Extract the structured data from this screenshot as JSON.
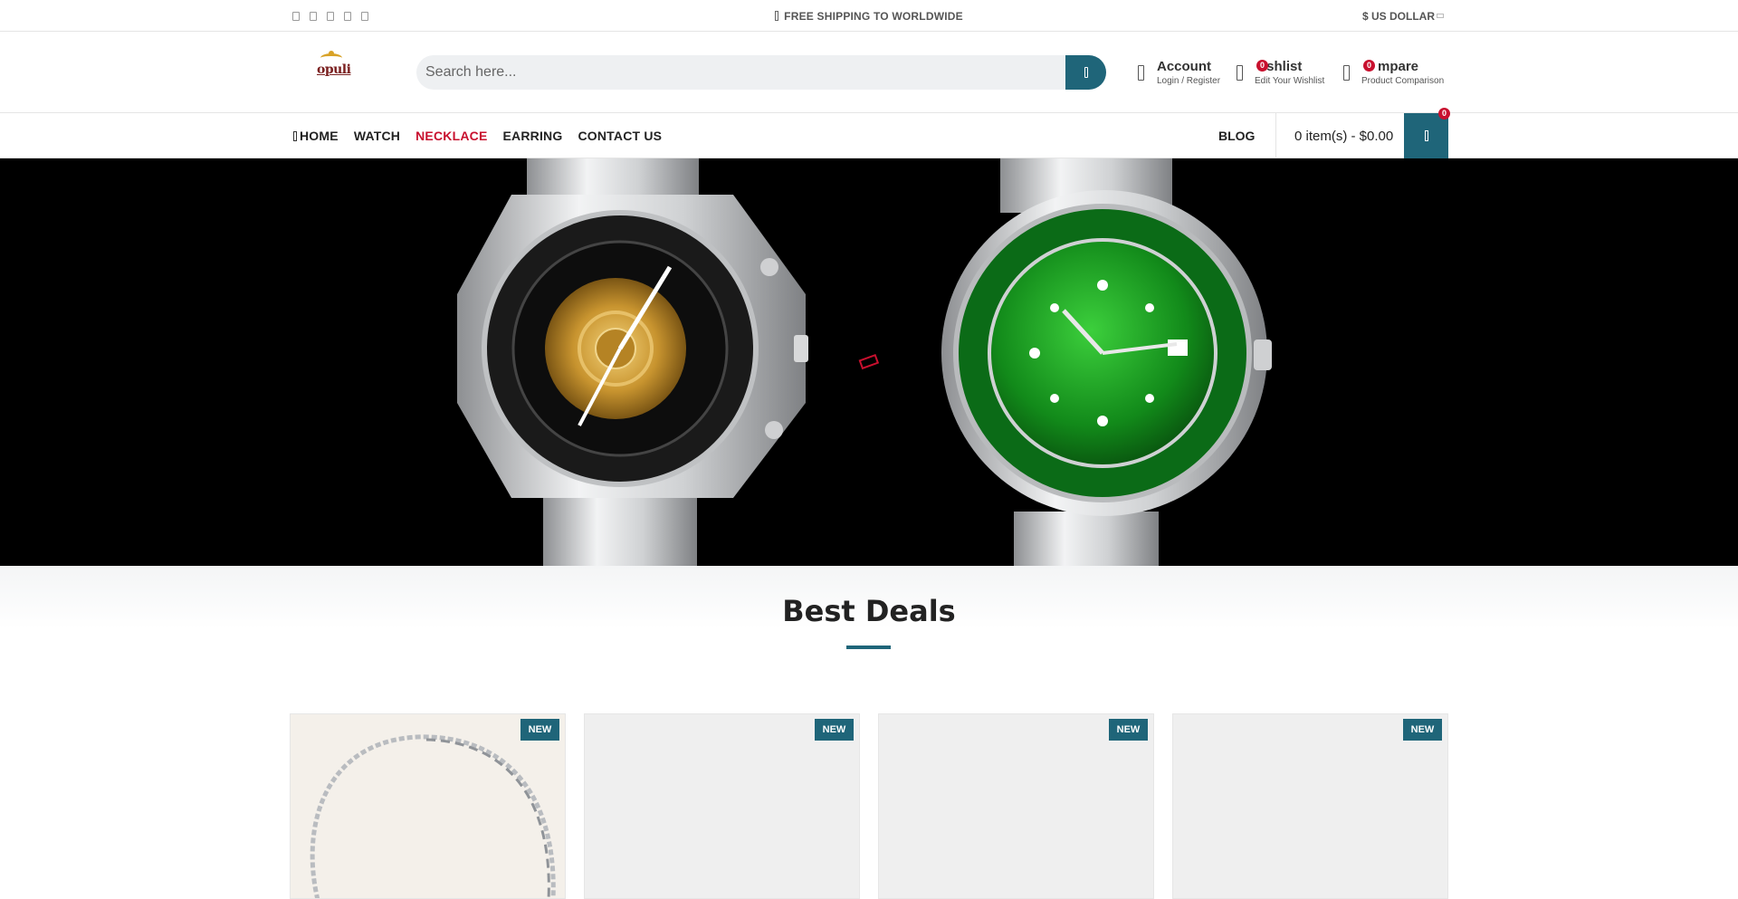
{
  "topbar": {
    "promo": "FREE SHIPPING TO WORLDWIDE",
    "currency": "$ US DOLLAR"
  },
  "header": {
    "logo_text": "opuli",
    "search_placeholder": "Search here...",
    "account": {
      "title": "Account",
      "subtitle": "Login / Register"
    },
    "wishlist": {
      "title": "ishlist",
      "subtitle": "Edit Your Wishlist",
      "count": "0"
    },
    "compare": {
      "title": "mpare",
      "subtitle": "Product Comparison",
      "count": "0"
    }
  },
  "nav": {
    "items": [
      {
        "label": "HOME"
      },
      {
        "label": "WATCH"
      },
      {
        "label": "NECKLACE"
      },
      {
        "label": "EARRING"
      },
      {
        "label": "CONTACT US"
      }
    ],
    "blog": "BLOG",
    "cart_text": "0 item(s) - $0.00",
    "cart_count": "0"
  },
  "section": {
    "title": "Best Deals"
  },
  "products": [
    {
      "badge": "NEW"
    },
    {
      "badge": "NEW"
    },
    {
      "badge": "NEW"
    },
    {
      "badge": "NEW"
    }
  ],
  "colors": {
    "accent": "#1f6579",
    "active_link": "#c8102e",
    "badge": "#c8102e"
  }
}
